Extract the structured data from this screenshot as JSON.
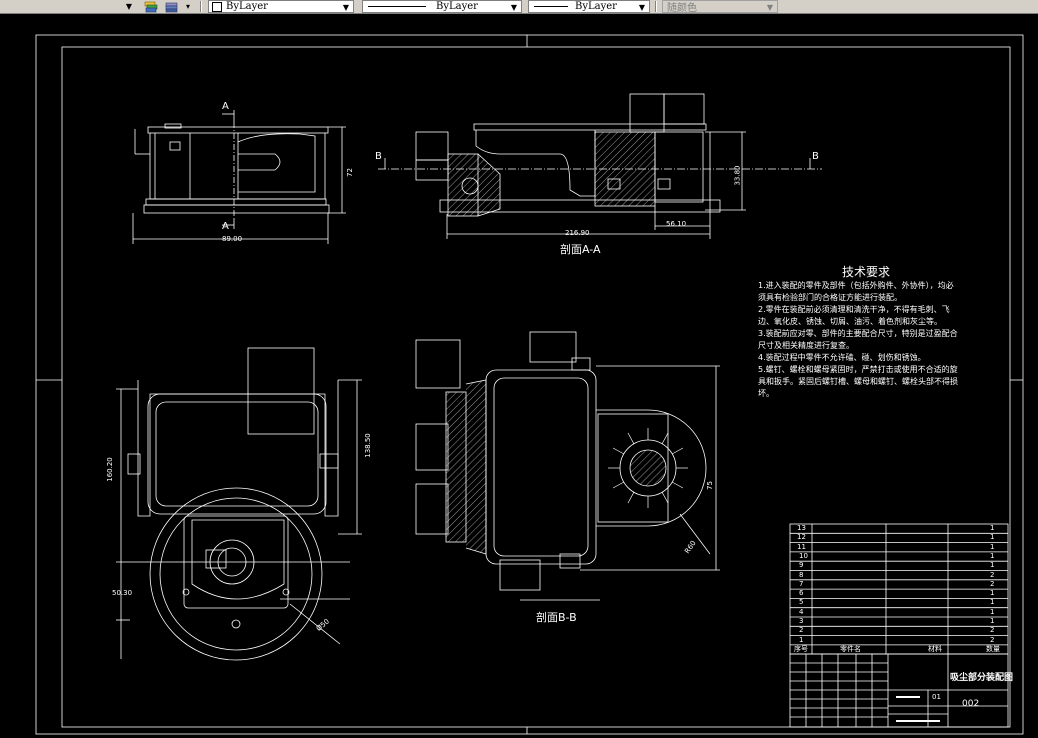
{
  "toolbar": {
    "layer_dropdown_label": "ByLayer",
    "linetype_dropdown_label": "ByLayer",
    "lineweight_dropdown_label": "ByLayer",
    "plotstyle_dropdown_label": "随颜色"
  },
  "drawing": {
    "section_aa_label": "剖面A-A",
    "section_bb_label": "剖面B-B",
    "cut_marker_a_top": "A",
    "cut_marker_a_bottom": "A",
    "cut_marker_b_left": "B",
    "cut_marker_b_right": "B",
    "dims": {
      "d_72": "72",
      "d_89": "89.00",
      "d_216": "216.90",
      "d_56": "56.10",
      "d_33": "33.80",
      "d_160": "160.20",
      "d_138": "138.50",
      "d_50": "50.30",
      "d_phi": "Ø50",
      "d_75": "75",
      "d_r": "R60"
    }
  },
  "notes": {
    "title": "技术要求",
    "lines": [
      "1.进入装配的零件及部件（包括外购件、外协件），均必",
      "须具有检验部门的合格证方能进行装配。",
      "2.零件在装配前必须清理和清洗干净，不得有毛刺、飞",
      "边、氧化皮、锈蚀、切屑、油污、着色剂和灰尘等。",
      "3.装配前应对零、部件的主要配合尺寸，特别是过盈配合",
      "尺寸及相关精度进行复查。",
      "4.装配过程中零件不允许磕、碰、划伤和锈蚀。",
      "5.螺钉、螺栓和螺母紧固时，严禁打击或使用不合适的旋",
      "具和扳手。紧固后螺钉槽、螺母和螺钉、螺栓头部不得损",
      "坏。"
    ]
  },
  "bom": {
    "rows": [
      {
        "no": "13",
        "qty": "1"
      },
      {
        "no": "12",
        "qty": "1"
      },
      {
        "no": "11",
        "qty": "1"
      },
      {
        "no": "10",
        "qty": "1"
      },
      {
        "no": "9",
        "qty": "1"
      },
      {
        "no": "8",
        "qty": "2"
      },
      {
        "no": "7",
        "qty": "2"
      },
      {
        "no": "6",
        "qty": "1"
      },
      {
        "no": "5",
        "qty": "1"
      },
      {
        "no": "4",
        "qty": "1"
      },
      {
        "no": "3",
        "qty": "1"
      },
      {
        "no": "2",
        "qty": "2"
      },
      {
        "no": "1",
        "qty": "2"
      }
    ],
    "header": {
      "no": "序号",
      "name": "零件名",
      "material": "材料",
      "qty": "数量"
    }
  },
  "title_block": {
    "drawing_name": "吸尘部分装配图",
    "drawing_number": "002",
    "sheet": "01"
  },
  "colors": {
    "background": "#000000",
    "line": "#ffffff",
    "toolbar": "#d4d0c8"
  }
}
